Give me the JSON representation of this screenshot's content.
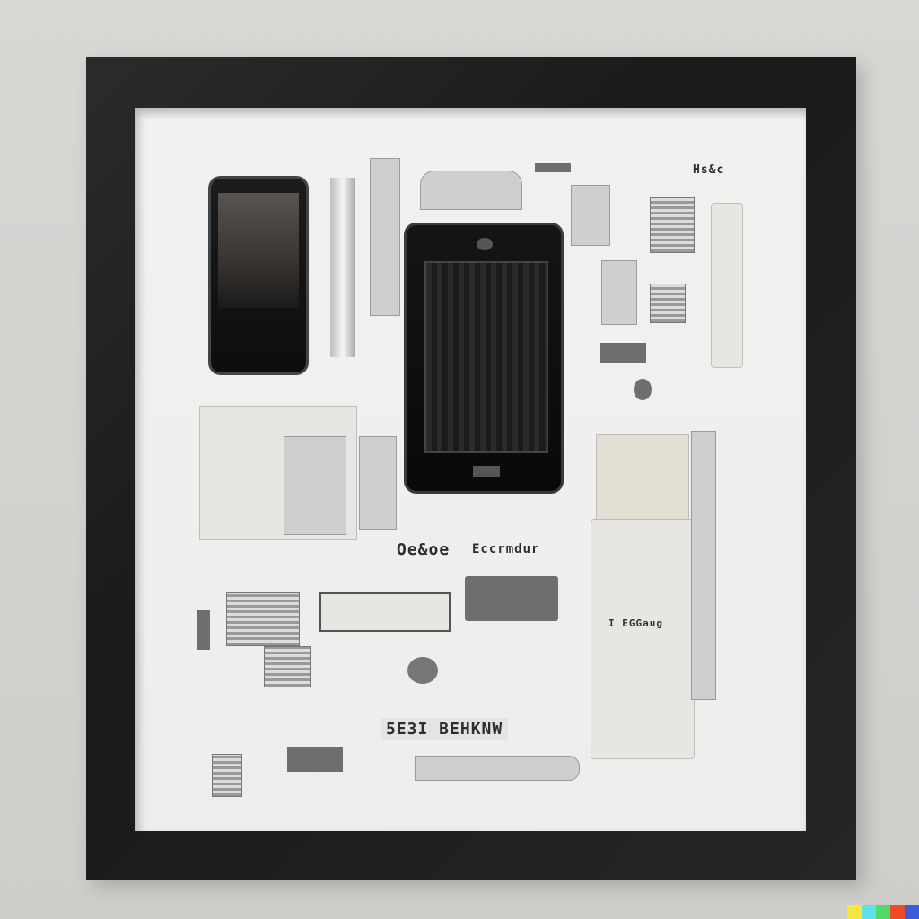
{
  "scene": {
    "subject": "framed-disassembled-smartphone",
    "colors": {
      "wall": "#d6d4d1",
      "frame": "#1f1f1f",
      "mat": "#f1f0ee",
      "phone": "#0e0e0e"
    }
  },
  "printed_labels": {
    "top_right": "Hs&c",
    "mid_left": "Oe&oe",
    "mid_center": "Eccrmdur",
    "module_label": "I  EGGaug",
    "bottom_center": "5E3I  BEHKNW"
  },
  "watermark": {
    "colors": [
      "#f5e642",
      "#5fe1e9",
      "#54d86a",
      "#ee4b2b",
      "#3b5bdb"
    ]
  }
}
